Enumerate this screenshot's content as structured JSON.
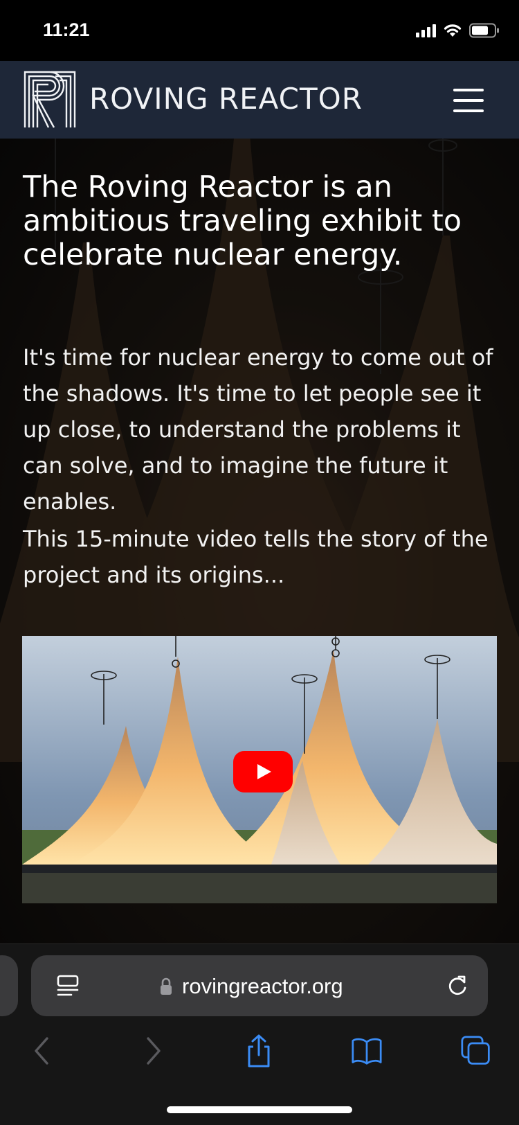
{
  "status_bar": {
    "time": "11:21",
    "icons": [
      "signal-icon",
      "wifi-icon",
      "battery-icon"
    ]
  },
  "site": {
    "title": "ROVING REACTOR",
    "menu_icon": "hamburger-menu-icon"
  },
  "content": {
    "headline": "The Roving Reactor is an ambitious traveling exhibit to celebrate nuclear energy.",
    "paragraph_1": "It's time for nuclear energy to come out of the shadows. It's time to let people see it up close, to understand the problems it can solve, and to imagine the future it enables.",
    "paragraph_2": "This 15-minute video tells the story of the project and its origins..."
  },
  "video": {
    "play_icon": "youtube-play-icon"
  },
  "browser": {
    "url": "rovingreactor.org",
    "icons": [
      "reader-icon",
      "lock-icon",
      "reload-icon",
      "back-icon",
      "forward-icon",
      "share-icon",
      "bookmarks-icon",
      "tabs-icon"
    ]
  },
  "colors": {
    "header_bg": "#1e2738",
    "accent_blue": "#3b8cf5",
    "youtube_red": "#ff0000"
  }
}
